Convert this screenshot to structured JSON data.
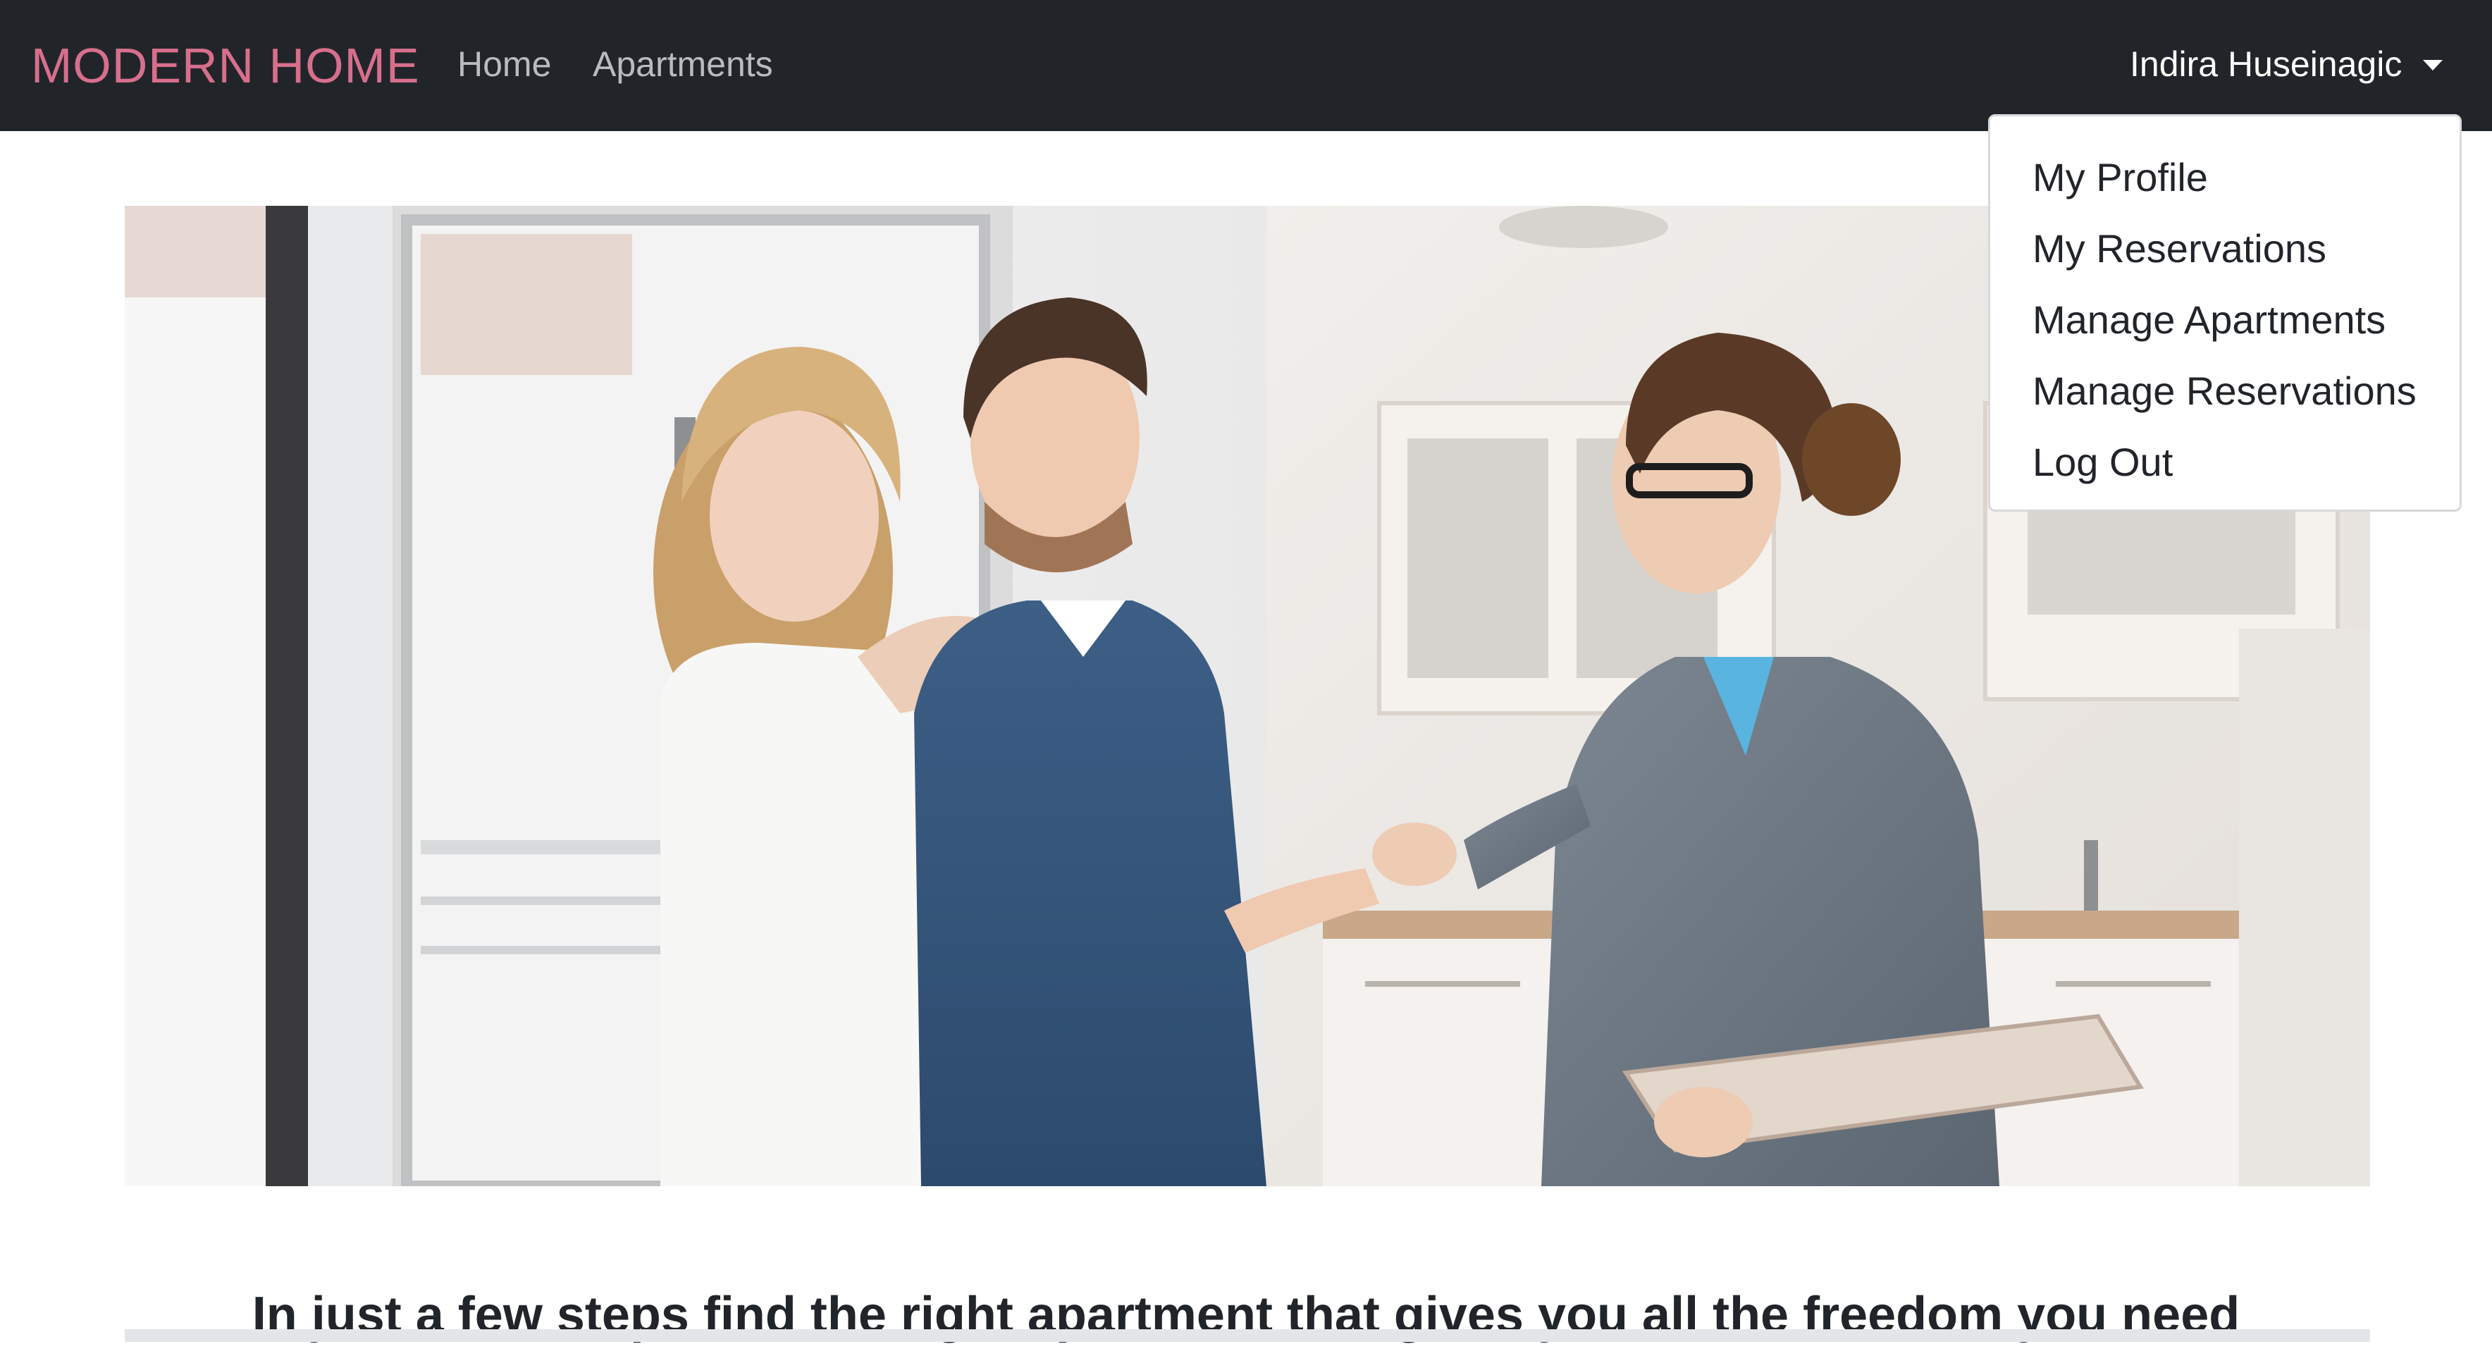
{
  "navbar": {
    "brand": "MODERN HOME",
    "links": [
      {
        "label": "Home"
      },
      {
        "label": "Apartments"
      }
    ],
    "user": {
      "name": "Indira Huseinagic",
      "menu_items": [
        {
          "label": "My Profile"
        },
        {
          "label": "My Reservations"
        },
        {
          "label": "Manage Apartments"
        },
        {
          "label": "Manage Reservations"
        },
        {
          "label": "Log Out"
        }
      ]
    }
  },
  "hero": {
    "image_subject": "real-estate-agent-handing-keys-to-couple"
  },
  "main": {
    "tagline": "In just a few steps find the right apartment that gives you all the freedom you need"
  },
  "colors": {
    "navbar_bg": "#212529",
    "brand": "#d76f8c",
    "nav_link": "#b9bcbf",
    "dropdown_border": "#d6d8db"
  }
}
